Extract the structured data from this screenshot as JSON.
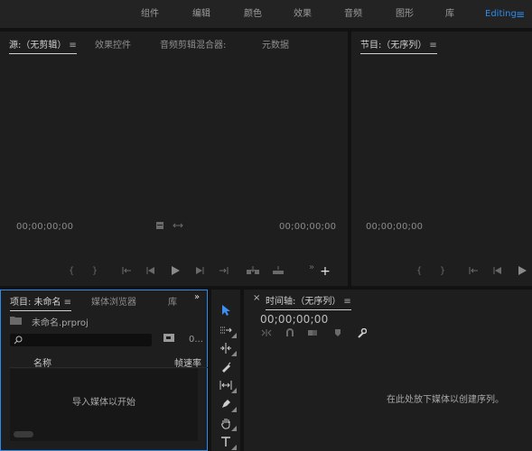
{
  "workspaces": {
    "tabs": [
      "组件",
      "编辑",
      "颜色",
      "效果",
      "音频",
      "图形",
      "库"
    ],
    "active": "Editing",
    "menu_icon": "hamburger-icon"
  },
  "source_panel": {
    "tabs": [
      "源:（无剪辑）",
      "效果控件",
      "音频剪辑混合器:",
      "元数据"
    ],
    "timecode_left": "00;00;00;00",
    "timecode_right": "00;00;00;00"
  },
  "program_panel": {
    "title": "节目:（无序列）",
    "timecode": "00;00;00;00"
  },
  "project_panel": {
    "tabs": [
      "项目: 未命名",
      "媒体浏览器",
      "库"
    ],
    "file_name": "未命名.prproj",
    "item_count": "0...",
    "columns": [
      "名称",
      "帧速率"
    ],
    "empty_text": "导入媒体以开始"
  },
  "timeline_panel": {
    "title": "时间轴:（无序列）",
    "timecode": "00;00;00;00",
    "empty_text": "在此处放下媒体以创建序列。"
  },
  "colors": {
    "accent": "#2d8ceb",
    "panel": "#1e1e1e",
    "background": "#121212"
  }
}
